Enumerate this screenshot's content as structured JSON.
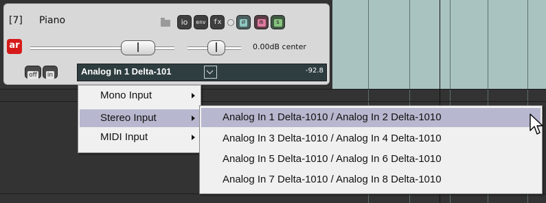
{
  "track": {
    "number": "[7]",
    "name": "Piano",
    "buttons": {
      "io": "io",
      "env": "env",
      "fx": "fx",
      "phase": "∅",
      "mute": "m",
      "solo": "s"
    },
    "arm_label": "ar",
    "volume_readout": "0.00dB center",
    "off_label": "off",
    "in_label": "in",
    "input_selected": "Analog In 1 Delta-101",
    "meter_value": "-92.8"
  },
  "menu": {
    "items": [
      {
        "label": "Mono Input"
      },
      {
        "label": "Stereo Input"
      },
      {
        "label": "MIDI Input"
      }
    ],
    "highlighted": "Stereo Input"
  },
  "submenu": {
    "items": [
      {
        "label": "Analog In 1 Delta-1010 / Analog In 2 Delta-1010"
      },
      {
        "label": "Analog In 3 Delta-1010 / Analog In 4 Delta-1010"
      },
      {
        "label": "Analog In 5 Delta-1010 / Analog In 6 Delta-1010"
      },
      {
        "label": "Analog In 7 Delta-1010 / Analog In 8 Delta-1010"
      }
    ],
    "highlighted": "Analog In 1 Delta-1010 / Analog In 2 Delta-1010"
  },
  "colors": {
    "arm": "#d61a1a",
    "highlight": "#b7b7cf",
    "arrange_track": "#a9c3c1"
  },
  "icons": [
    "folder-icon",
    "chevron-down-icon",
    "submenu-arrow-icon",
    "mouse-pointer-icon"
  ]
}
